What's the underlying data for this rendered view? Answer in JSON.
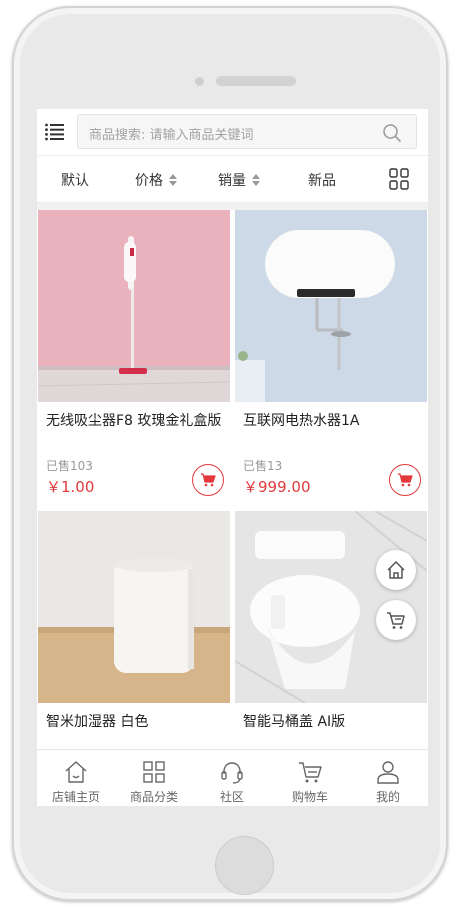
{
  "search": {
    "placeholder": "商品搜索: 请输入商品关键词"
  },
  "sort": {
    "default": "默认",
    "price": "价格",
    "sales": "销量",
    "new": "新品"
  },
  "products": [
    {
      "name": "无线吸尘器F8 玫瑰金礼盒版",
      "sold": "已售103",
      "price": "￥1.00"
    },
    {
      "name": "互联网电热水器1A",
      "sold": "已售13",
      "price": "￥999.00"
    },
    {
      "name": "智米加湿器 白色"
    },
    {
      "name": "智能马桶盖 AI版"
    }
  ],
  "nav": {
    "home": "店铺主页",
    "category": "商品分类",
    "community": "社区",
    "cart": "购物车",
    "mine": "我的"
  },
  "colors": {
    "accent": "#e4393c",
    "text": "#333333",
    "muted": "#999999"
  },
  "icons": [
    "list-icon",
    "search-icon",
    "grid-icon",
    "cart-icon",
    "home-icon",
    "category-icon",
    "headset-icon",
    "shopping-cart-icon",
    "user-icon"
  ]
}
